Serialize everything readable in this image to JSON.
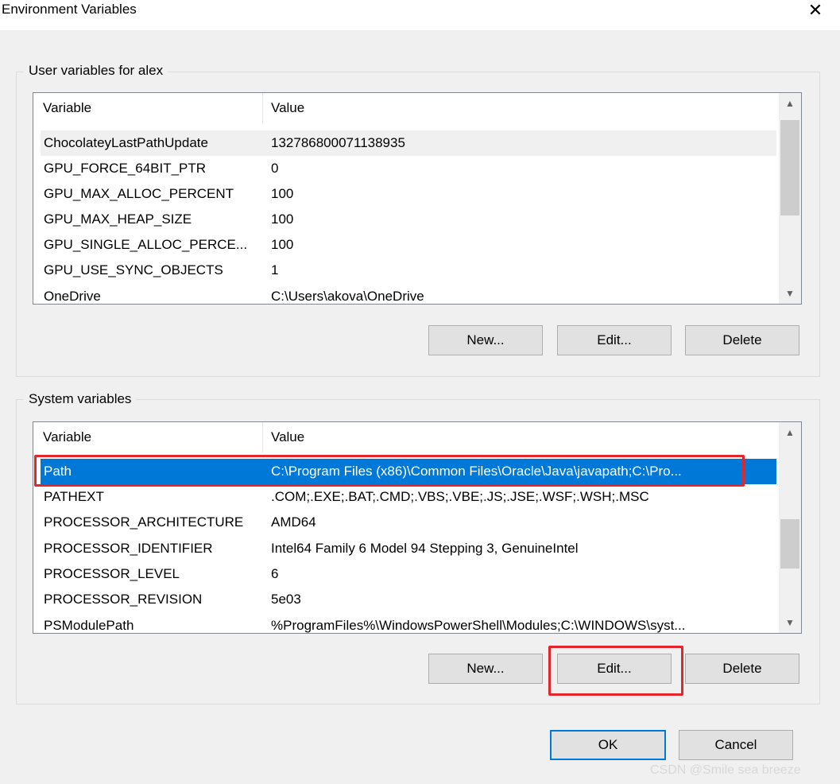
{
  "window": {
    "title": "Environment Variables",
    "close_glyph": "✕"
  },
  "user_section": {
    "label": "User variables for alex",
    "columns": {
      "variable": "Variable",
      "value": "Value"
    },
    "rows": [
      {
        "name": "ChocolateyLastPathUpdate",
        "value": "132786800071138935"
      },
      {
        "name": "GPU_FORCE_64BIT_PTR",
        "value": "0"
      },
      {
        "name": "GPU_MAX_ALLOC_PERCENT",
        "value": "100"
      },
      {
        "name": "GPU_MAX_HEAP_SIZE",
        "value": "100"
      },
      {
        "name": "GPU_SINGLE_ALLOC_PERCE...",
        "value": "100"
      },
      {
        "name": "GPU_USE_SYNC_OBJECTS",
        "value": "1"
      },
      {
        "name": "OneDrive",
        "value": "C:\\Users\\akova\\OneDrive"
      }
    ],
    "buttons": {
      "new": "New...",
      "edit": "Edit...",
      "delete": "Delete"
    }
  },
  "system_section": {
    "label": "System variables",
    "columns": {
      "variable": "Variable",
      "value": "Value"
    },
    "rows": [
      {
        "name": "Path",
        "value": "C:\\Program Files (x86)\\Common Files\\Oracle\\Java\\javapath;C:\\Pro..."
      },
      {
        "name": "PATHEXT",
        "value": ".COM;.EXE;.BAT;.CMD;.VBS;.VBE;.JS;.JSE;.WSF;.WSH;.MSC"
      },
      {
        "name": "PROCESSOR_ARCHITECTURE",
        "value": "AMD64"
      },
      {
        "name": "PROCESSOR_IDENTIFIER",
        "value": "Intel64 Family 6 Model 94 Stepping 3, GenuineIntel"
      },
      {
        "name": "PROCESSOR_LEVEL",
        "value": "6"
      },
      {
        "name": "PROCESSOR_REVISION",
        "value": "5e03"
      },
      {
        "name": "PSModulePath",
        "value": "%ProgramFiles%\\WindowsPowerShell\\Modules;C:\\WINDOWS\\syst..."
      }
    ],
    "buttons": {
      "new": "New...",
      "edit": "Edit...",
      "delete": "Delete"
    }
  },
  "footer": {
    "ok": "OK",
    "cancel": "Cancel"
  },
  "watermark": "CSDN @Smile sea breeze",
  "icons": {
    "scroll_up": "▲",
    "scroll_down": "▼"
  },
  "colors": {
    "selection": "#0078d7",
    "highlight_box": "#e3262b"
  }
}
